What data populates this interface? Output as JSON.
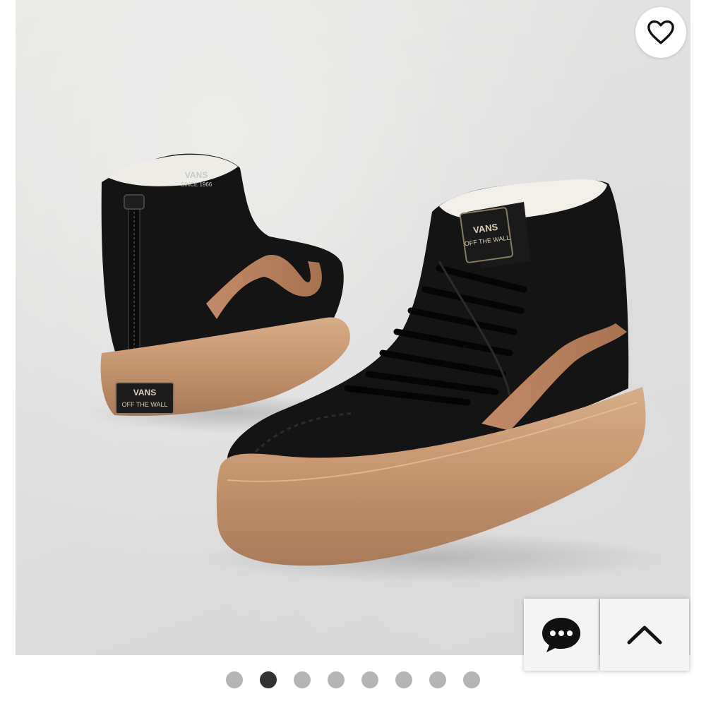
{
  "product_image": {
    "brand_logo_text": "VANS",
    "tagline_text": "OFF THE WALL",
    "since_text": "SINCE 1966",
    "colors": {
      "suede": "#141414",
      "sole": "#c99a74",
      "stripe": "#b57f5e",
      "collar_lining": "#f1efea"
    }
  },
  "favorite_button": {
    "icon": "heart-outline-icon"
  },
  "chat_button": {
    "icon": "chat-bubble-icon"
  },
  "scroll_top_button": {
    "icon": "chevron-up-icon"
  },
  "carousel": {
    "total_slides": 8,
    "active_index": 1
  }
}
